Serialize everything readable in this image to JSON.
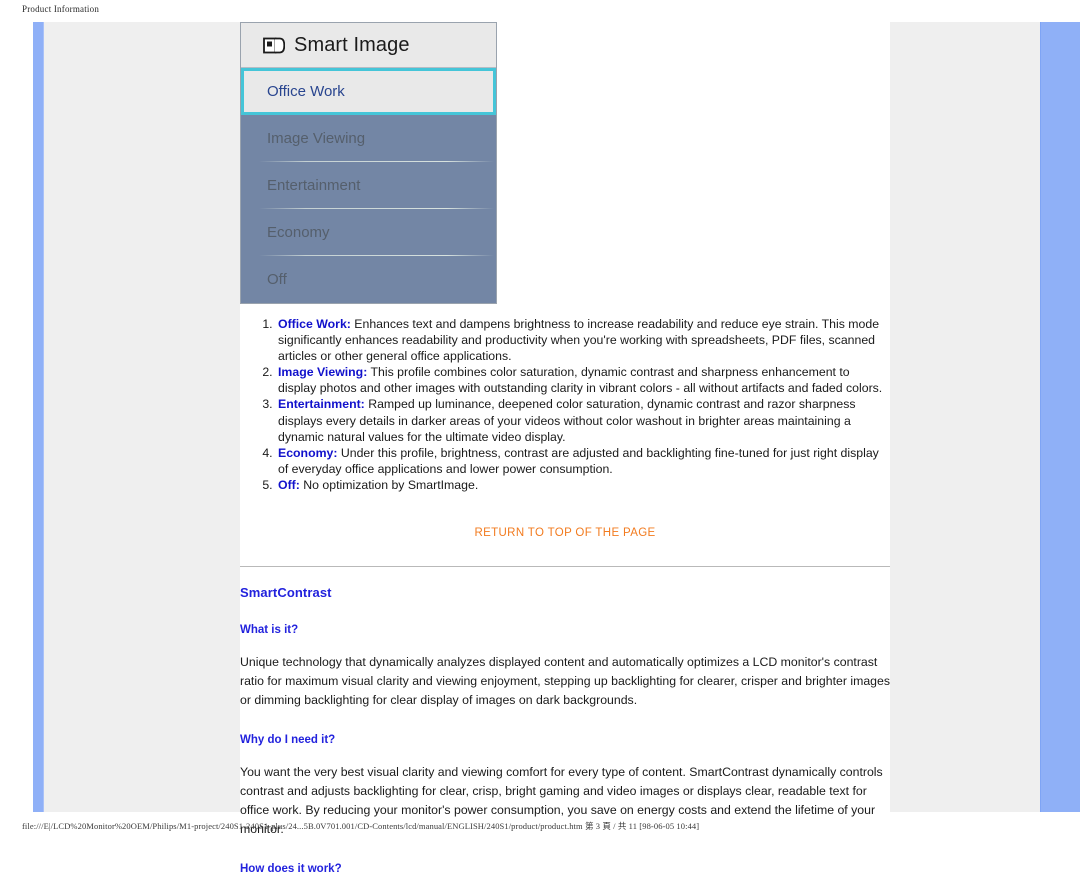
{
  "print": {
    "header_title": "Product Information",
    "footer_path": "file:///E|/LCD%20Monitor%20OEM/Philips/M1-project/240S1-240S1-plus/24...5B.0V701.001/CD-Contents/lcd/manual/ENGLISH/240S1/product/product.htm 第 3 頁 / 共 11 [98-06-05 10:44]"
  },
  "osd": {
    "icon": "smart-image-icon",
    "title": "Smart Image",
    "items": [
      {
        "label": "Office Work",
        "selected": true
      },
      {
        "label": "Image Viewing",
        "selected": false
      },
      {
        "label": "Entertainment",
        "selected": false
      },
      {
        "label": "Economy",
        "selected": false
      },
      {
        "label": "Off",
        "selected": false
      }
    ]
  },
  "profiles": [
    {
      "term": "Office Work:",
      "desc": " Enhances text and dampens brightness to increase readability and reduce eye strain. This mode significantly enhances readability and productivity when you're working with spreadsheets, PDF files, scanned articles or other general office applications."
    },
    {
      "term": "Image Viewing:",
      "desc": " This profile combines color saturation, dynamic contrast and sharpness enhancement to display photos and other images with outstanding clarity in vibrant colors - all without artifacts and faded colors."
    },
    {
      "term": "Entertainment:",
      "desc": " Ramped up luminance, deepened color saturation, dynamic contrast and razor sharpness displays every details in darker areas of your videos without color washout in brighter areas maintaining a dynamic natural values for the ultimate video display."
    },
    {
      "term": "Economy:",
      "desc": " Under this profile, brightness, contrast are adjusted and backlighting fine-tuned for just right display of everyday office applications and lower power consumption."
    },
    {
      "term": "Off:",
      "desc": " No optimization by SmartImage."
    }
  ],
  "return_link": "RETURN TO TOP OF THE PAGE",
  "smartcontrast": {
    "title": "SmartContrast",
    "what_heading": "What is it?",
    "what_body": "Unique technology that dynamically analyzes displayed content and automatically optimizes a LCD monitor's contrast ratio for maximum visual clarity and viewing enjoyment, stepping up backlighting for clearer, crisper and brighter images or dimming backlighting for clear display of images on dark backgrounds.",
    "why_heading": "Why do I need it?",
    "why_body": "You want the very best visual clarity and viewing comfort for every type of content. SmartContrast dynamically controls contrast and adjusts backlighting for clear, crisp, bright gaming and video images or displays clear, readable text for office work. By reducing your monitor's power consumption, you save on energy costs and extend the lifetime of your monitor.",
    "how_heading": "How does it work?"
  },
  "colors": {
    "link_blue": "#2222dd",
    "orange": "#f27b1f",
    "osd_blue_bg": "#7386a5",
    "osd_selected_border": "#45c5d8",
    "rail_blue": "#8fb0f7",
    "page_gray": "#efefef"
  }
}
